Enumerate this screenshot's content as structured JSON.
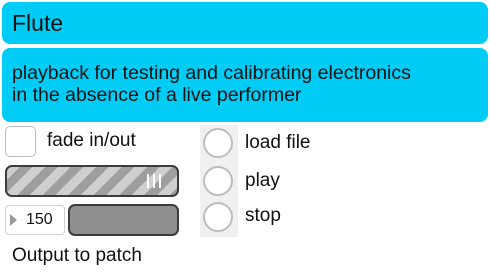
{
  "header": {
    "title": "Flute"
  },
  "description": {
    "line1": "playback for testing and calibrating electronics",
    "line2": "in the absence of a live performer"
  },
  "controls": {
    "fade_label": "fade in/out",
    "fade_checked": false,
    "number_value": "150",
    "output_label": "Output to patch"
  },
  "playback": {
    "options": [
      {
        "label": "load file"
      },
      {
        "label": "play"
      },
      {
        "label": "stop"
      }
    ]
  },
  "colors": {
    "panel_accent": "#00ccf5"
  }
}
